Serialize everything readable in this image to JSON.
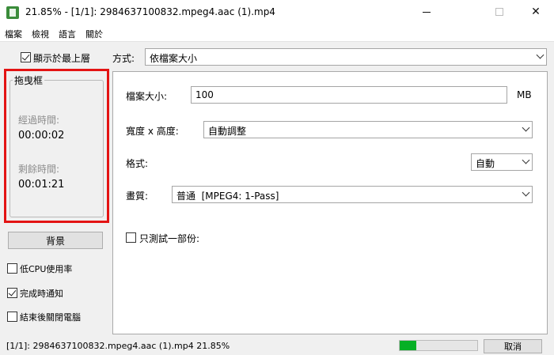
{
  "window": {
    "title": "21.85% - [1/1]: 2984637100832.mpeg4.aac (1).mp4",
    "app_icon": "app-icon",
    "minimize_icon": "minimize-icon",
    "maximize_icon": "maximize-icon",
    "close_icon": "close-icon",
    "close_glyph": "✕"
  },
  "menu": {
    "items": [
      "檔案",
      "檢視",
      "語言",
      "關於"
    ]
  },
  "sidebar": {
    "topmost_label": "顯示於最上層",
    "topmost_checked": true,
    "drag_box_title": "拖曳框",
    "elapsed_label": "經過時間:",
    "elapsed_value": "00:00:02",
    "remaining_label": "剩餘時間:",
    "remaining_value": "00:01:21",
    "highlight_color": "#e31313",
    "background_button": "背景",
    "options": [
      {
        "label": "低CPU使用率",
        "checked": false
      },
      {
        "label": "完成時通知",
        "checked": true
      },
      {
        "label": "結束後關閉電腦",
        "checked": false
      }
    ]
  },
  "settings": {
    "mode_label": "方式:",
    "mode_value": "依檔案大小",
    "file_size_label": "檔案大小:",
    "file_size_value": "100",
    "file_size_unit": "MB",
    "dimension_label": "寬度 x 高度:",
    "dimension_value": "自動調整",
    "format_label": "格式:",
    "format_value": "自動",
    "quality_label": "畫質:",
    "quality_value": "普通  [MPEG4: 1-Pass]",
    "test_part_label": "只測試一部份:",
    "test_part_checked": false
  },
  "status": {
    "text": "[1/1]: 2984637100832.mpeg4.aac (1).mp4  21.85%",
    "progress": 0.2185,
    "progress_color": "#06b025",
    "cancel_button": "取消"
  }
}
